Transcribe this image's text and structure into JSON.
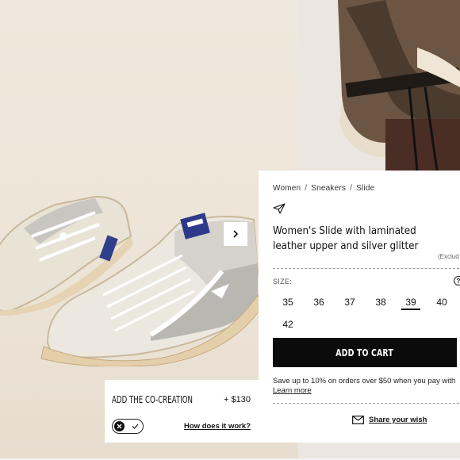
{
  "gallery": {
    "next_icon": "chevron-right-icon"
  },
  "product": {
    "breadcrumb": [
      "Women",
      "Sneakers",
      "Slide"
    ],
    "title": "Women's Slide with laminated leather upper and silver glitter",
    "price_note": "(Exclud",
    "size_label": "SIZE:",
    "size_help_icon": "question-circle-icon",
    "sizes": [
      "35",
      "36",
      "37",
      "38",
      "39",
      "40",
      "42"
    ],
    "selected_size": "39",
    "add_to_cart_label": "ADD TO CART",
    "save_text": "Save up to 10% on orders over $50 when you pay with",
    "learn_more_label": "Learn more",
    "share_label": "Share your wish",
    "share_icon": "envelope-icon",
    "badge_icon": "paper-plane-icon"
  },
  "cocreation": {
    "title": "ADD THE CO-CREATION",
    "price": "+ $130",
    "how_label": "How does it work?",
    "toggle_state": "off"
  },
  "colors": {
    "button_bg": "#0b0b0b",
    "photo_bg": "#ece4d7"
  }
}
